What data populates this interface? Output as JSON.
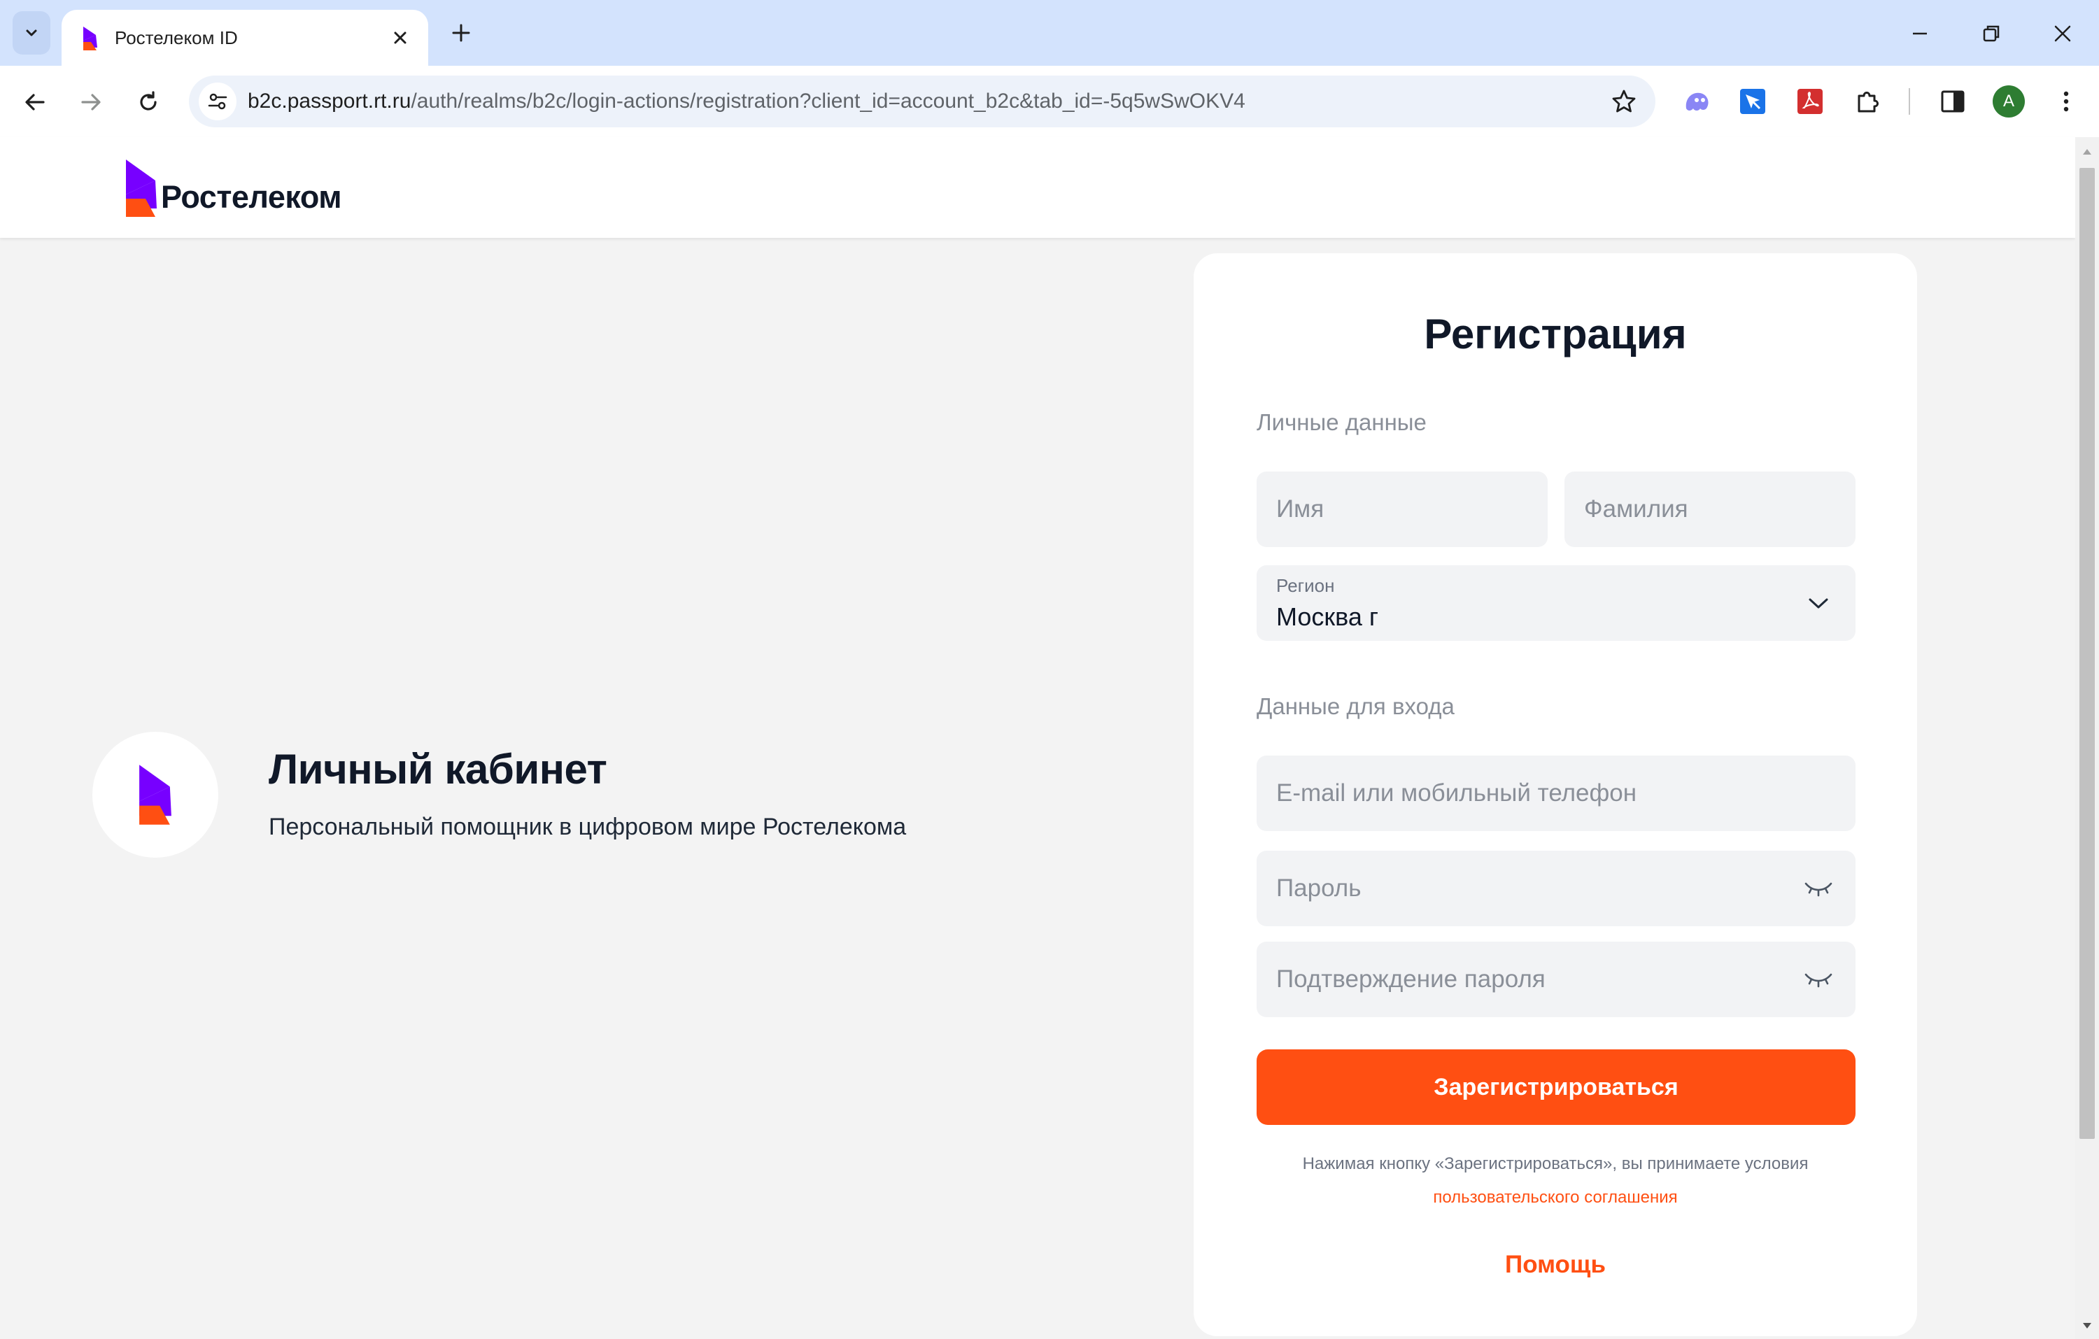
{
  "browser": {
    "tab_title": "Ростелеком ID",
    "url_host": "b2c.passport.rt.ru",
    "url_path": "/auth/realms/b2c/login-actions/registration?client_id=account_b2c&tab_id=-5q5wSwOKV4",
    "profile_initial": "A",
    "icons": [
      "chevron-down-icon",
      "close-icon",
      "plus-icon",
      "minimize-icon",
      "restore-icon",
      "close-window-icon",
      "back-arrow-icon",
      "forward-arrow-icon",
      "reload-icon",
      "site-info-icon",
      "star-icon",
      "extension-ghost-icon",
      "extension-arrow-icon",
      "pdf-icon",
      "puzzle-icon",
      "side-panel-icon",
      "more-vert-icon"
    ]
  },
  "header": {
    "logo_text": "Ростелеком"
  },
  "promo": {
    "title": "Личный кабинет",
    "subtitle": "Персональный помощник в цифровом мире Ростелекома"
  },
  "form": {
    "title": "Регистрация",
    "personal_label": "Личные данные",
    "first_name_placeholder": "Имя",
    "last_name_placeholder": "Фамилия",
    "region_label": "Регион",
    "region_value": "Москва г",
    "login_label": "Данные для входа",
    "login_placeholder": "E-mail или мобильный телефон",
    "password_placeholder": "Пароль",
    "password_confirm_placeholder": "Подтверждение пароля",
    "submit_label": "Зарегистрироваться",
    "terms_text": "Нажимая кнопку «Зарегистрироваться», вы принимаете условия",
    "terms_link": "пользовательского соглашения",
    "help_label": "Помощь"
  },
  "colors": {
    "brand_orange": "#ff4f12",
    "brand_purple": "#7700ff",
    "text_dark": "#101828",
    "page_bg": "#f3f3f3",
    "field_bg": "#f2f3f5"
  }
}
